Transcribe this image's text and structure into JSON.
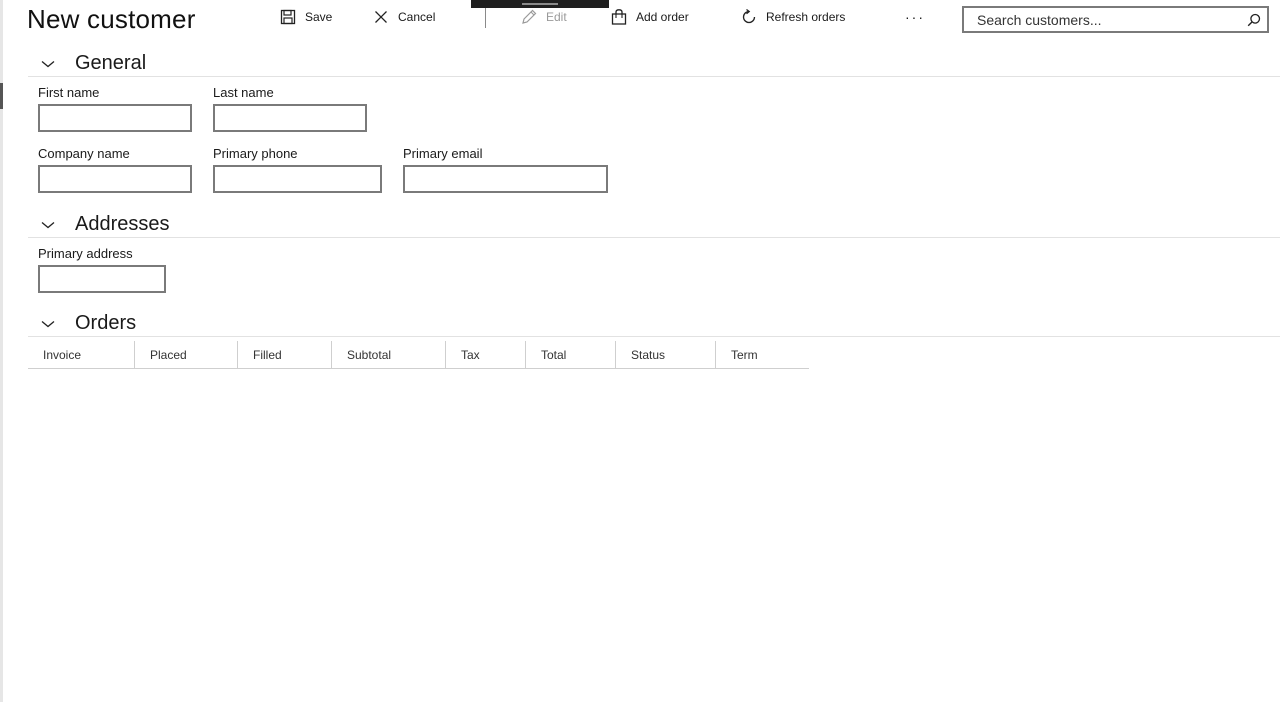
{
  "page": {
    "title": "New customer"
  },
  "toolbar": {
    "save_label": "Save",
    "cancel_label": "Cancel",
    "edit_label": "Edit",
    "add_order_label": "Add order",
    "refresh_orders_label": "Refresh orders",
    "more_label": "···"
  },
  "search": {
    "placeholder": "Search customers..."
  },
  "sections": {
    "general": {
      "title": "General",
      "first_name_label": "First name",
      "last_name_label": "Last name",
      "company_name_label": "Company name",
      "primary_phone_label": "Primary phone",
      "primary_email_label": "Primary email",
      "first_name_value": "",
      "last_name_value": "",
      "company_name_value": "",
      "primary_phone_value": "",
      "primary_email_value": ""
    },
    "addresses": {
      "title": "Addresses",
      "primary_address_label": "Primary address",
      "primary_address_value": ""
    },
    "orders": {
      "title": "Orders",
      "columns": [
        "Invoice",
        "Placed",
        "Filled",
        "Subtotal",
        "Tax",
        "Total",
        "Status",
        "Term"
      ],
      "rows": []
    }
  },
  "icons": {
    "save": "save-icon",
    "cancel": "close-icon",
    "edit": "pencil-icon",
    "add_order": "shopping-bag-icon",
    "refresh": "refresh-icon",
    "search": "search-icon",
    "chevron": "chevron-down-icon"
  },
  "colors": {
    "input_border": "#7a7a7a",
    "divider": "#e2e2e2",
    "disabled_text": "#9a9a9a"
  }
}
